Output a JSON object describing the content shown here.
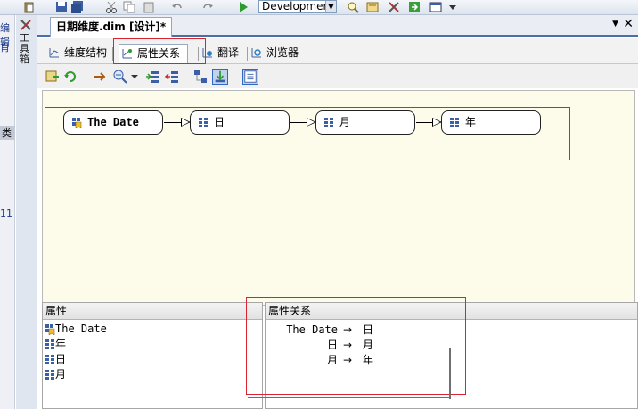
{
  "toolbar": {
    "config_value": "Developmer"
  },
  "left_strip": {
    "fragment_top": "编辑",
    "fragment_top2": "肖",
    "fragment_mid": "类",
    "fragment_num": "11"
  },
  "toolbox": {
    "label": "工具箱"
  },
  "document": {
    "tab_title": "日期维度.dim [设计]*"
  },
  "designer_tabs": [
    {
      "label": "维度结构"
    },
    {
      "label": "属性关系"
    },
    {
      "label": "翻译"
    },
    {
      "label": "浏览器"
    }
  ],
  "diagram": {
    "nodes": [
      {
        "label": "The Date",
        "icon": "key-attribute-icon"
      },
      {
        "label": "日",
        "icon": "attribute-grid-icon"
      },
      {
        "label": "月",
        "icon": "attribute-grid-icon"
      },
      {
        "label": "年",
        "icon": "attribute-grid-icon"
      }
    ]
  },
  "attributes_pane": {
    "header": "属性",
    "items": [
      {
        "label": "The Date",
        "icon": "key-attribute-icon"
      },
      {
        "label": "年",
        "icon": "attribute-grid-icon"
      },
      {
        "label": "日",
        "icon": "attribute-grid-icon"
      },
      {
        "label": "月",
        "icon": "attribute-grid-icon"
      }
    ]
  },
  "relations_pane": {
    "header": "属性关系",
    "rows": [
      {
        "source": "The Date",
        "arrow": "→",
        "target": "日"
      },
      {
        "source": "日",
        "arrow": "→",
        "target": "月"
      },
      {
        "source": "月",
        "arrow": "→",
        "target": "年"
      }
    ]
  },
  "colors": {
    "canvas_bg": "#fdfbea",
    "highlight": "#d9232e",
    "accent": "#316ac5"
  }
}
